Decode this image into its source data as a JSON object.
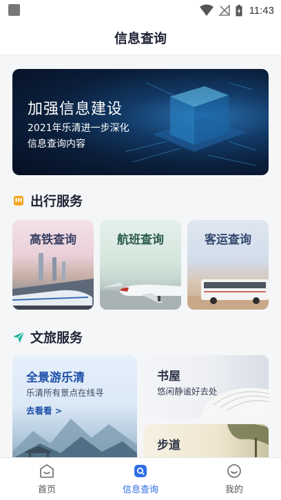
{
  "status_bar": {
    "time": "11:43"
  },
  "header": {
    "title": "信息查询"
  },
  "banner": {
    "title": "加强信息建设",
    "subtitle_line1": "2021年乐清进一步深化",
    "subtitle_line2": "信息查询内容"
  },
  "travel_section": {
    "title": "出行服务",
    "cards": [
      {
        "label": "高铁查询"
      },
      {
        "label": "航班查询"
      },
      {
        "label": "客运查询"
      }
    ]
  },
  "culture_section": {
    "title": "文旅服务",
    "feature_card": {
      "title": "全景游乐清",
      "subtitle": "乐清所有景点在线寻",
      "link": "去看看 >"
    },
    "cards": [
      {
        "title": "书屋",
        "subtitle": "悠闲静谧好去处"
      },
      {
        "title": "步道",
        "subtitle": ""
      }
    ]
  },
  "tab_bar": {
    "tabs": [
      {
        "label": "首页"
      },
      {
        "label": "信息查询"
      },
      {
        "label": "我的"
      }
    ],
    "active_index": 1
  },
  "colors": {
    "accent": "#2f6ee6",
    "title_text": "#1e2233",
    "travel_icon": "#f5a623",
    "culture_icon": "#1fb5a0"
  },
  "icons": {
    "travel_section": "bus-icon",
    "culture_section": "paper-plane-icon",
    "tabs": [
      "home-icon",
      "search-icon",
      "smiley-icon"
    ]
  }
}
